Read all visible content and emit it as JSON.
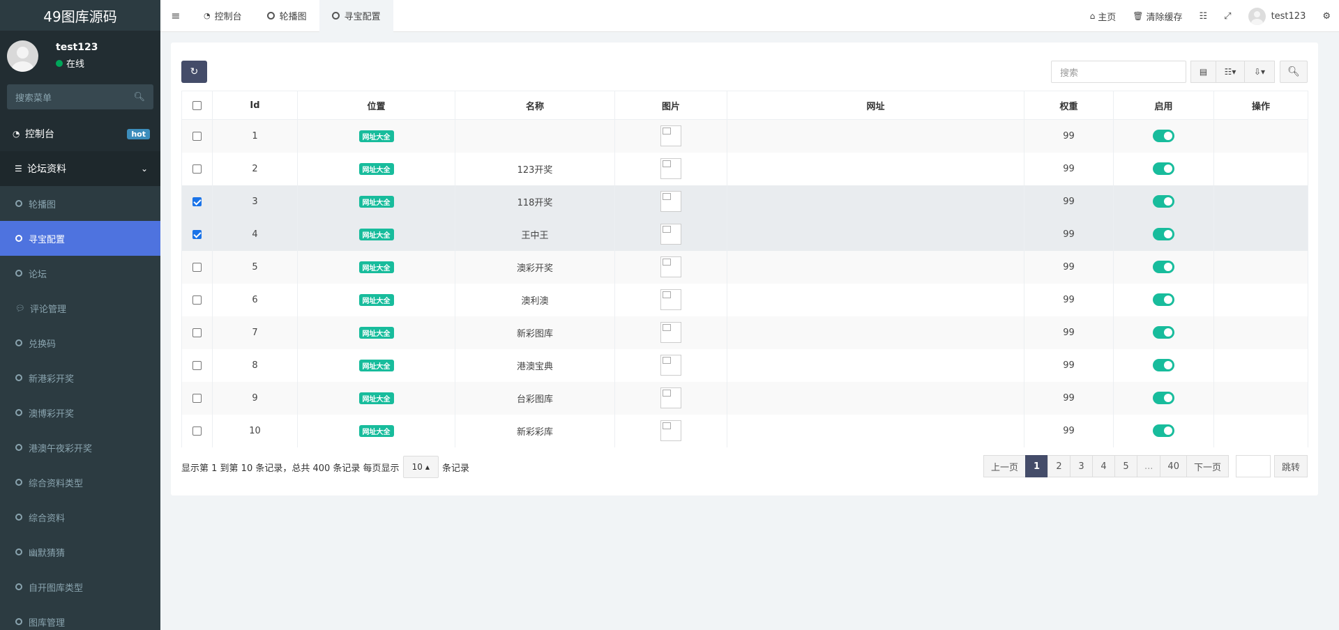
{
  "app": {
    "title": "49图库源码"
  },
  "user": {
    "name": "test123",
    "status": "在线"
  },
  "sidebar": {
    "search_placeholder": "搜索菜单",
    "dashboard": {
      "label": "控制台",
      "badge": "hot"
    },
    "group": {
      "label": "论坛资料"
    },
    "items": [
      {
        "label": "轮播图",
        "active": false
      },
      {
        "label": "寻宝配置",
        "active": true
      },
      {
        "label": "论坛",
        "active": false
      },
      {
        "label": "评论管理",
        "active": false,
        "icon": "comments-icon"
      },
      {
        "label": "兑换码",
        "active": false
      },
      {
        "label": "新港彩开奖",
        "active": false
      },
      {
        "label": "澳博彩开奖",
        "active": false
      },
      {
        "label": "港澳午夜彩开奖",
        "active": false
      },
      {
        "label": "综合资料类型",
        "active": false
      },
      {
        "label": "综合资料",
        "active": false
      },
      {
        "label": "幽默猜猜",
        "active": false
      },
      {
        "label": "自开图库类型",
        "active": false
      },
      {
        "label": "图库管理",
        "active": false
      }
    ]
  },
  "topbar": {
    "tabs": [
      {
        "label": "控制台",
        "icon": "dashboard-icon"
      },
      {
        "label": "轮播图",
        "icon": "circle-icon"
      },
      {
        "label": "寻宝配置",
        "icon": "circle-icon"
      }
    ],
    "home": "主页",
    "clear_cache": "清除缓存",
    "username": "test123"
  },
  "toolbar": {
    "search_placeholder": "搜索"
  },
  "table": {
    "columns": [
      "Id",
      "位置",
      "名称",
      "图片",
      "网址",
      "权重",
      "启用",
      "操作"
    ],
    "rows": [
      {
        "id": "1",
        "location": "网址大全",
        "name": "",
        "url": "",
        "weight": "99",
        "enabled": true,
        "checked": false
      },
      {
        "id": "2",
        "location": "网址大全",
        "name": "123开奖",
        "url": "",
        "weight": "99",
        "enabled": true,
        "checked": false
      },
      {
        "id": "3",
        "location": "网址大全",
        "name": "118开奖",
        "url": "",
        "weight": "99",
        "enabled": true,
        "checked": true
      },
      {
        "id": "4",
        "location": "网址大全",
        "name": "王中王",
        "url": "",
        "weight": "99",
        "enabled": true,
        "checked": true
      },
      {
        "id": "5",
        "location": "网址大全",
        "name": "澳彩开奖",
        "url": "",
        "weight": "99",
        "enabled": true,
        "checked": false
      },
      {
        "id": "6",
        "location": "网址大全",
        "name": "澳利澳",
        "url": "",
        "weight": "99",
        "enabled": true,
        "checked": false
      },
      {
        "id": "7",
        "location": "网址大全",
        "name": "新彩图库",
        "url": "",
        "weight": "99",
        "enabled": true,
        "checked": false
      },
      {
        "id": "8",
        "location": "网址大全",
        "name": "港澳宝典",
        "url": "",
        "weight": "99",
        "enabled": true,
        "checked": false
      },
      {
        "id": "9",
        "location": "网址大全",
        "name": "台彩图库",
        "url": "",
        "weight": "99",
        "enabled": true,
        "checked": false
      },
      {
        "id": "10",
        "location": "网址大全",
        "name": "新彩彩库",
        "url": "",
        "weight": "99",
        "enabled": true,
        "checked": false
      }
    ]
  },
  "footer": {
    "summary": "显示第 1 到第 10 条记录，总共 400 条记录 每页显示",
    "page_size": "10",
    "suffix": "条记录"
  },
  "pagination": {
    "prev": "上一页",
    "pages": [
      "1",
      "2",
      "3",
      "4",
      "5",
      "...",
      "40"
    ],
    "current": "1",
    "next": "下一页",
    "jump": "跳转"
  },
  "colors": {
    "sidebar_bg": "#222d32",
    "active": "#4e73df",
    "primary": "#444c69",
    "success": "#18bc9c"
  }
}
